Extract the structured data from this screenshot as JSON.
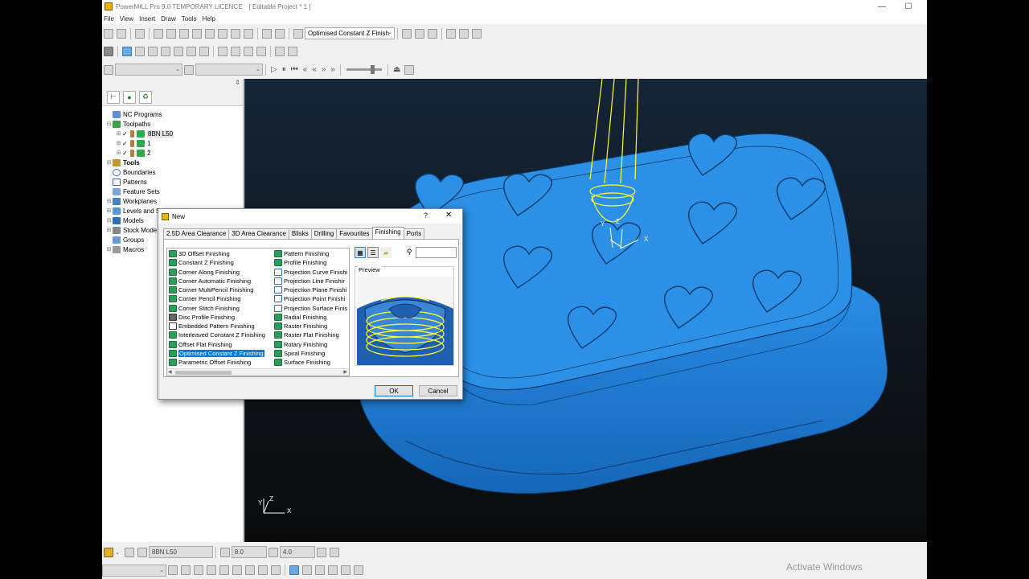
{
  "window": {
    "title": "PowerMILL Pro 9.0 TEMPORARY LICENCE",
    "project": "[ Editable Project * 1 ]",
    "minimize": "—",
    "maximize": "☐"
  },
  "menu": [
    "File",
    "View",
    "Insert",
    "Draw",
    "Tools",
    "Help"
  ],
  "toolbar": {
    "strategy_select": "Optimised Constant Z Finish"
  },
  "explorer": {
    "pin": "⇕",
    "items": [
      {
        "label": "NC Programs",
        "expander": ""
      },
      {
        "label": "Toolpaths",
        "expander": "⊟"
      },
      {
        "label": "8BN L50",
        "expander": "⊞"
      },
      {
        "label": "1",
        "expander": "⊞"
      },
      {
        "label": "2",
        "expander": "⊞"
      },
      {
        "label": "Tools",
        "expander": "⊞"
      },
      {
        "label": "Boundaries",
        "expander": ""
      },
      {
        "label": "Patterns",
        "expander": ""
      },
      {
        "label": "Feature Sets",
        "expander": ""
      },
      {
        "label": "Workplanes",
        "expander": "⊞"
      },
      {
        "label": "Levels and S",
        "expander": "⊞"
      },
      {
        "label": "Models",
        "expander": "⊞"
      },
      {
        "label": "Stock Mode",
        "expander": "⊞"
      },
      {
        "label": "Groups",
        "expander": ""
      },
      {
        "label": "Macros",
        "expander": "⊞"
      }
    ]
  },
  "dialog": {
    "title": "New",
    "help": "?",
    "close": "✕",
    "tabs": [
      "2.5D Area Clearance",
      "3D Area Clearance",
      "Blisks",
      "Drilling",
      "Favourites",
      "Finishing",
      "Ports"
    ],
    "active_tab": "Finishing",
    "strategies_col1": [
      "3D Offset Finishing",
      "Constant Z Finishing",
      "Corner Along Finishing",
      "Corner Automatic Finishing",
      "Corner MultiPencil Finishing",
      "Corner Pencil Finishing",
      "Corner Stitch Finishing",
      "Disc Profile Finishing",
      "Embedded Pattern Finishing",
      "Interleaved Constant Z Finishing",
      "Offset Flat Finishing",
      "Optimised Constant Z Finishing",
      "Parametric Offset Finishing"
    ],
    "strategies_col2": [
      "Pattern Finishing",
      "Profile Finishing",
      "Projection Curve Finishi",
      "Projection Line Finishir",
      "Projection Plane Finishi",
      "Projection Point Finishi",
      "Projection Surface Finis",
      "Radial Finishing",
      "Raster Finishing",
      "Raster Flat Finishing",
      "Rotary Finishing",
      "Spiral Finishing",
      "Surface Finishing"
    ],
    "selected": "Optimised Constant Z Finishing",
    "preview_label": "Preview",
    "search_value": "",
    "ok": "OK",
    "cancel": "Cancel"
  },
  "viewport": {
    "tool_axes": {
      "x": "X",
      "y": "Y",
      "z": "Z"
    },
    "triad": {
      "x": "X",
      "y": "Y",
      "z": "Z"
    }
  },
  "bottom": {
    "tool_name": "8BN L50",
    "diameter": "8.0",
    "length": "4.0"
  },
  "watermark": {
    "line1": "Activate Windows"
  },
  "colors": {
    "model": "#2d8fe0",
    "model_dark": "#1a6fbf",
    "toolpath": "#ffff33",
    "selection": "#0078d7"
  }
}
